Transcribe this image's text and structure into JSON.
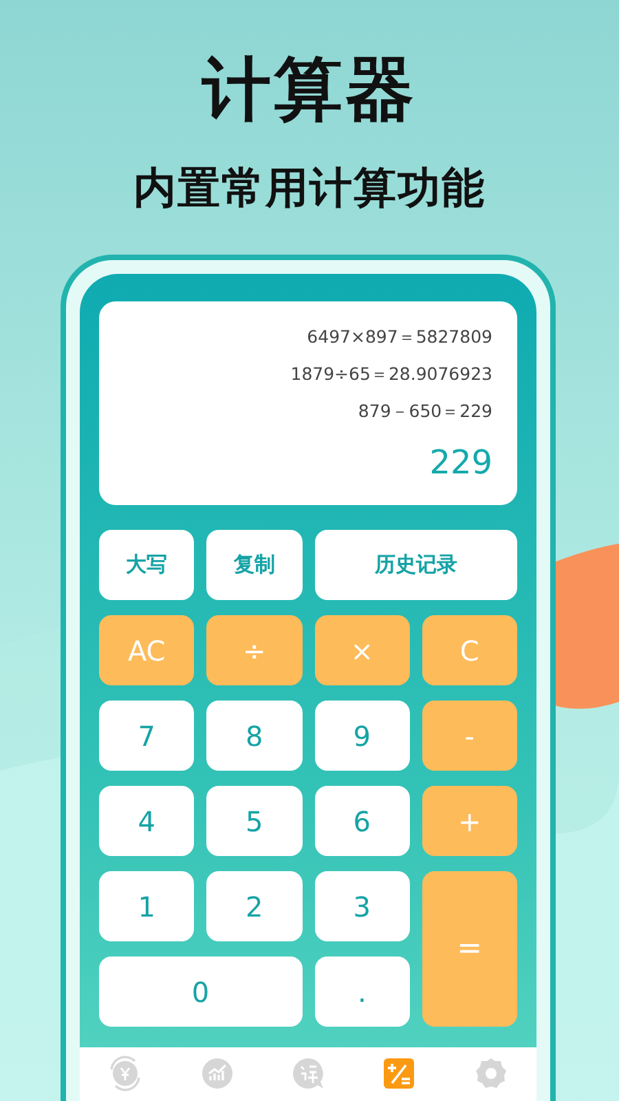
{
  "header": {
    "title": "计算器",
    "subtitle": "内置常用计算功能"
  },
  "display": {
    "history": [
      "6497×897＝5827809",
      "1879÷65＝28.9076923",
      "879－650＝229"
    ],
    "result": "229"
  },
  "keys": [
    {
      "label": "大写",
      "kind": "text"
    },
    {
      "label": "复制",
      "kind": "text"
    },
    {
      "label": "历史记录",
      "kind": "text-wide"
    },
    {
      "label": "AC",
      "kind": "operator"
    },
    {
      "label": "÷",
      "kind": "operator"
    },
    {
      "label": "×",
      "kind": "operator"
    },
    {
      "label": "C",
      "kind": "operator"
    },
    {
      "label": "7",
      "kind": "digit"
    },
    {
      "label": "8",
      "kind": "digit"
    },
    {
      "label": "9",
      "kind": "digit"
    },
    {
      "label": "-",
      "kind": "operator"
    },
    {
      "label": "4",
      "kind": "digit"
    },
    {
      "label": "5",
      "kind": "digit"
    },
    {
      "label": "6",
      "kind": "digit"
    },
    {
      "label": "+",
      "kind": "operator"
    },
    {
      "label": "1",
      "kind": "digit"
    },
    {
      "label": "2",
      "kind": "digit"
    },
    {
      "label": "3",
      "kind": "digit"
    },
    {
      "label": "=",
      "kind": "equals"
    },
    {
      "label": "0",
      "kind": "zero"
    },
    {
      "label": ".",
      "kind": "digit"
    }
  ],
  "tab_bar": [
    {
      "kind": "currency",
      "selected": false
    },
    {
      "kind": "chart",
      "selected": false
    },
    {
      "kind": "translate",
      "selected": false
    },
    {
      "kind": "calculator",
      "selected": true
    },
    {
      "kind": "settings",
      "selected": false
    }
  ]
}
